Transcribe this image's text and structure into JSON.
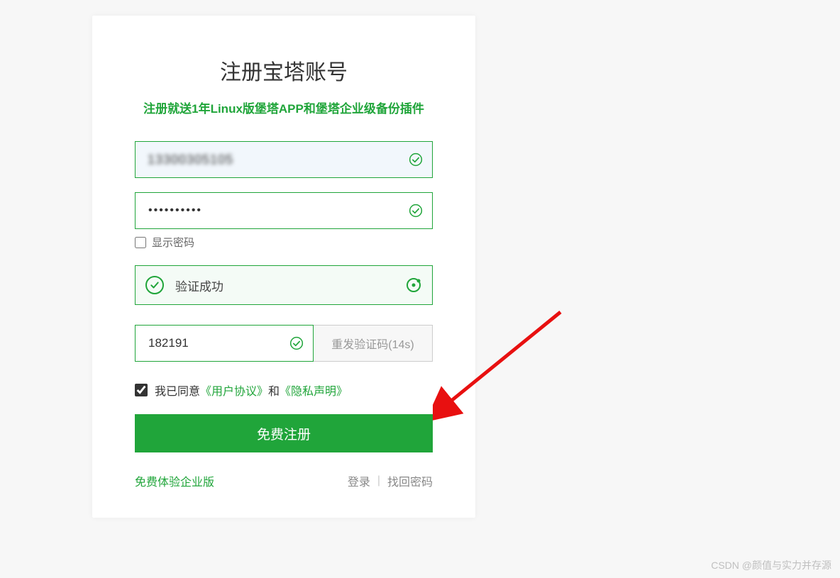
{
  "header": {
    "title": "注册宝塔账号",
    "subtitle": "注册就送1年Linux版堡塔APP和堡塔企业级备份插件"
  },
  "phone": {
    "value": "13300305105"
  },
  "password": {
    "value": "••••••••••",
    "show_label": "显示密码"
  },
  "captcha": {
    "success_text": "验证成功"
  },
  "code": {
    "value": "182191",
    "resend_label": "重发验证码(14s)"
  },
  "agree": {
    "prefix": "我已同意",
    "link1": "《用户协议》",
    "mid": "和",
    "link2": "《隐私声明》"
  },
  "submit": {
    "label": "免费注册"
  },
  "footer": {
    "trial": "免费体验企业版",
    "login": "登录",
    "find_pwd": "找回密码"
  },
  "watermark": "CSDN @颜值与实力并存源",
  "colors": {
    "primary": "#20a53a"
  }
}
